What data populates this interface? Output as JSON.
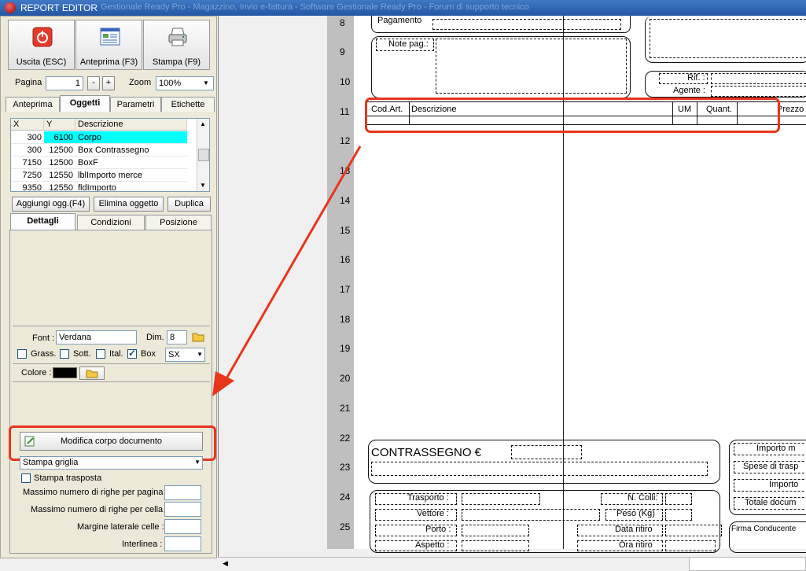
{
  "window": {
    "title": "REPORT EDITOR",
    "subtitle": "Gestionale Ready Pro - Magazzino, Invio e-fattura - Software Gestionale Ready Pro - Forum di supporto tecnico"
  },
  "toolbar": {
    "exit_label": "Uscita (ESC)",
    "preview_label": "Anteprima (F3)",
    "print_label": "Stampa (F9)"
  },
  "page_controls": {
    "page_label": "Pagina",
    "page_value": "1",
    "minus": "-",
    "plus": "+",
    "zoom_label": "Zoom",
    "zoom_value": "100%"
  },
  "tabs_top": [
    "Anteprima",
    "Oggetti",
    "Parametri",
    "Etichette"
  ],
  "objects_table": {
    "columns": [
      "X",
      "Y",
      "Descrizione"
    ],
    "rows": [
      {
        "x": "300",
        "y": "6100",
        "desc": "Corpo"
      },
      {
        "x": "300",
        "y": "12500",
        "desc": "Box Contrassegno"
      },
      {
        "x": "7150",
        "y": "12500",
        "desc": "BoxF"
      },
      {
        "x": "7250",
        "y": "12550",
        "desc": "lblImporto merce"
      },
      {
        "x": "9350",
        "y": "12550",
        "desc": "fldImporto"
      }
    ]
  },
  "object_buttons": {
    "add": "Aggiungi ogg.(F4)",
    "delete": "Elimina oggetto",
    "duplicate": "Duplica"
  },
  "tabs_detail": [
    "Dettagli",
    "Condizioni",
    "Posizione"
  ],
  "font_settings": {
    "font_label": "Font :",
    "font_value": "Verdana",
    "size_label": "Dim.",
    "size_value": "8",
    "bold_label": "Grass.",
    "underline_label": "Sott.",
    "italic_label": "Ital.",
    "box_label": "Box",
    "align_value": "SX",
    "color_label": "Colore :",
    "color_value": "#000000"
  },
  "body_section": {
    "edit_button": "Modifica corpo documento",
    "grid_select": "Stampa griglia",
    "transpose_label": "Stampa trasposta",
    "max_rows_page": "Massimo numero di righe per pagina :",
    "max_rows_cell": "Massimo numero di righe per cella :",
    "cell_margin": "Margine laterale celle :",
    "line_spacing": "Interlinea :"
  },
  "ruler": [
    "8",
    "9",
    "10",
    "11",
    "12",
    "13",
    "14",
    "15",
    "16",
    "17",
    "18",
    "19",
    "20",
    "21",
    "22",
    "23",
    "24",
    "25"
  ],
  "page_labels": {
    "payment": "Pagamento",
    "note_pag": "Note pag.:",
    "rif": "Rif. :",
    "agente": "Agente :",
    "cod_art": "Cod.Art.",
    "descrizione": "Descrizione",
    "um": "UM",
    "quant": "Quant.",
    "prezzo": "Prezzo",
    "contrassegno": "CONTRASSEGNO €",
    "importo_m": "Importo m",
    "spese": "Spese di trasp",
    "importo": "Importo",
    "totale": "Totale docum",
    "trasporto": "Trasporto :",
    "vettore": "Vettore :",
    "porto": "Porto :",
    "aspetto": "Aspetto :",
    "n_colli": "N. Colli:",
    "peso": "Peso (Kg)",
    "data_ritiro": "Data ritiro",
    "ora_ritiro": "Ora ritiro",
    "firma": "Firma Conducente"
  },
  "colors": {
    "highlight": "#e8361c",
    "selection": "#00ffff",
    "ruler": "#bfbfbf"
  }
}
